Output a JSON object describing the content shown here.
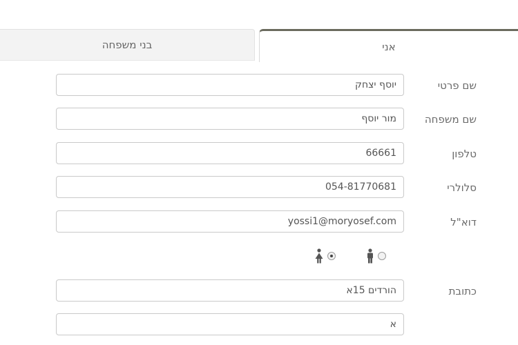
{
  "tabs": {
    "me": "אני",
    "family": "בני משפחה",
    "active": "me"
  },
  "form": {
    "first_name": {
      "label": "שם פרטי",
      "value": "יוסף יצחק"
    },
    "last_name": {
      "label": "שם משפחה",
      "value": "מור יוסף"
    },
    "phone": {
      "label": "טלפון",
      "value": "66661"
    },
    "mobile": {
      "label": "סלולרי",
      "value": "054-81770681"
    },
    "email": {
      "label": "דוא\"ל",
      "value": "yossi1@moryosef.com"
    },
    "gender": {
      "options": [
        "male",
        "female"
      ],
      "selected": "female"
    },
    "address": {
      "label": "כתובת",
      "value": "הורדים 15א"
    },
    "address2": {
      "value": "א"
    }
  },
  "colors": {
    "active_tab_border": "#6b6b5e",
    "inactive_tab_bg": "#f3f3f3",
    "field_border": "#c9c9c9"
  },
  "icons": {
    "male": "male-figure-icon",
    "female": "female-figure-icon"
  }
}
